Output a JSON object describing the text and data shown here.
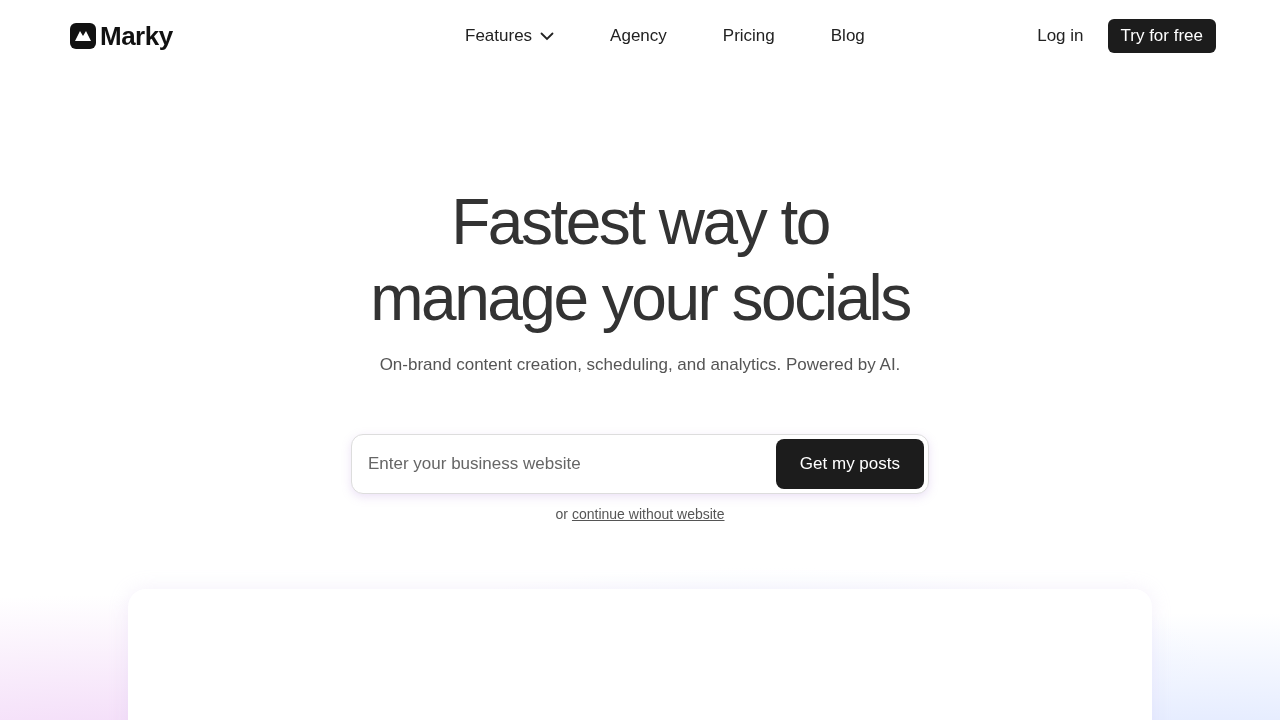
{
  "brand": {
    "name": "Marky"
  },
  "nav": [
    {
      "label": "Features",
      "kind": "dropdown"
    },
    {
      "label": "Agency",
      "kind": "link"
    },
    {
      "label": "Pricing",
      "kind": "link"
    },
    {
      "label": "Blog",
      "kind": "link"
    }
  ],
  "actions": {
    "login": "Log in",
    "cta": "Try for free"
  },
  "hero": {
    "title": "Fastest way to\nmanage your socials",
    "subtitle": "On-brand content creation, scheduling, and analytics. Powered by AI.",
    "input": {
      "placeholder": "Enter your business website"
    },
    "button": "Get my posts",
    "alt_prefix": "or",
    "alt_link": "continue without website"
  }
}
